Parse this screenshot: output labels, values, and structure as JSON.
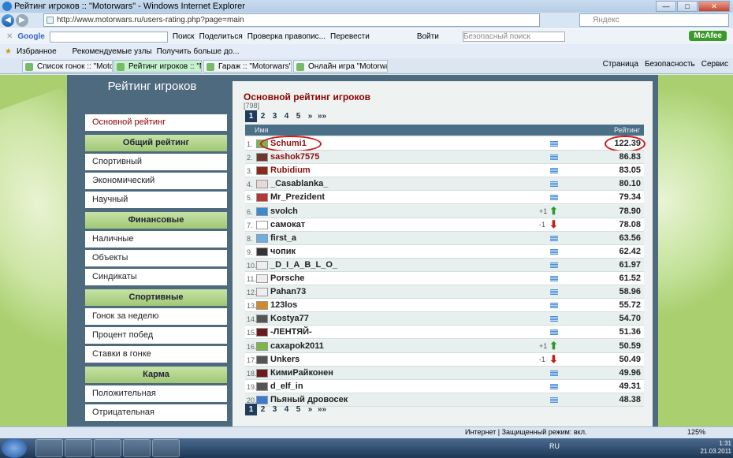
{
  "window": {
    "title": "Рейтинг игроков :: \"Motorwars\" - Windows Internet Explorer",
    "min": "—",
    "max": "□",
    "close": "✕"
  },
  "address": {
    "url": "http://www.motorwars.ru/users-rating.php?page=main",
    "search_placeholder": "Яндекс"
  },
  "google_bar": {
    "label": "Google",
    "search": "Поиск",
    "share": "Поделиться",
    "spell": "Проверка правопис...",
    "translate": "Перевести",
    "login": "Войти",
    "safe_search": "Безопасный поиск",
    "mcafee": "McAfee"
  },
  "favorites": {
    "label": "Избранное",
    "items": [
      "Рекомендуемые узлы",
      "Получить больше до..."
    ]
  },
  "tabs": [
    "Список гонок :: \"Motorwa...",
    "Рейтинг игроков :: \"M...",
    "Гараж :: \"Motorwars\"",
    "Онлайн игра \"Motorwars\""
  ],
  "ie_tools": [
    "Страница",
    "Безопасность",
    "Сервис"
  ],
  "sidebar": {
    "title": "Рейтинг игроков",
    "top": "Основной рейтинг",
    "sections": [
      {
        "head": "Общий рейтинг",
        "items": [
          "Спортивный",
          "Экономический",
          "Научный"
        ]
      },
      {
        "head": "Финансовые",
        "items": [
          "Наличные",
          "Объекты",
          "Синдикаты"
        ]
      },
      {
        "head": "Спортивные",
        "items": [
          "Гонок за неделю",
          "Процент побед",
          "Ставки в гонке"
        ]
      },
      {
        "head": "Карма",
        "items": [
          "Положительная",
          "Отрицательная"
        ]
      }
    ]
  },
  "main": {
    "title": "Основной рейтинг игроков",
    "count": "[798]",
    "pages": [
      "1",
      "2",
      "3",
      "4",
      "5",
      "»",
      "»»"
    ],
    "col_name": "Имя",
    "col_rating": "Рейтинг",
    "rows": [
      {
        "n": "1.",
        "name": "Schumi1",
        "rating": "122.39",
        "red": true,
        "delta": "",
        "dir": ""
      },
      {
        "n": "2.",
        "name": "sashok7575",
        "rating": "86.83",
        "red": true,
        "delta": "",
        "dir": ""
      },
      {
        "n": "3.",
        "name": "Rubidium",
        "rating": "83.05",
        "red": true,
        "delta": "",
        "dir": ""
      },
      {
        "n": "4.",
        "name": "_Casablanka_",
        "rating": "80.10",
        "red": false,
        "delta": "",
        "dir": ""
      },
      {
        "n": "5.",
        "name": "Mr_Prezident",
        "rating": "79.34",
        "red": false,
        "delta": "",
        "dir": ""
      },
      {
        "n": "6.",
        "name": "svolch",
        "rating": "78.90",
        "red": false,
        "delta": "+1",
        "dir": "up"
      },
      {
        "n": "7.",
        "name": "самокат",
        "rating": "78.08",
        "red": false,
        "delta": "-1",
        "dir": "down"
      },
      {
        "n": "8.",
        "name": "first_a",
        "rating": "63.56",
        "red": false,
        "delta": "",
        "dir": ""
      },
      {
        "n": "9.",
        "name": "чопик",
        "rating": "62.42",
        "red": false,
        "delta": "",
        "dir": ""
      },
      {
        "n": "10.",
        "name": "_D_I_A_B_L_O_",
        "rating": "61.97",
        "red": false,
        "delta": "",
        "dir": ""
      },
      {
        "n": "11.",
        "name": "Porsche",
        "rating": "61.52",
        "red": false,
        "delta": "",
        "dir": ""
      },
      {
        "n": "12.",
        "name": "Pahan73",
        "rating": "58.96",
        "red": false,
        "delta": "",
        "dir": ""
      },
      {
        "n": "13.",
        "name": "123los",
        "rating": "55.72",
        "red": false,
        "delta": "",
        "dir": ""
      },
      {
        "n": "14.",
        "name": "Kostya77",
        "rating": "54.70",
        "red": false,
        "delta": "",
        "dir": ""
      },
      {
        "n": "15.",
        "name": "-ЛЕНТЯЙ-",
        "rating": "51.36",
        "red": false,
        "delta": "",
        "dir": ""
      },
      {
        "n": "16.",
        "name": "caxapok2011",
        "rating": "50.59",
        "red": false,
        "delta": "+1",
        "dir": "up"
      },
      {
        "n": "17.",
        "name": "Unkers",
        "rating": "50.49",
        "red": false,
        "delta": "-1",
        "dir": "down"
      },
      {
        "n": "18.",
        "name": "КимиРайконен",
        "rating": "49.96",
        "red": false,
        "delta": "",
        "dir": ""
      },
      {
        "n": "19.",
        "name": "d_elf_in",
        "rating": "49.31",
        "red": false,
        "delta": "",
        "dir": ""
      },
      {
        "n": "20.",
        "name": "Пьяный дровосек",
        "rating": "48.38",
        "red": false,
        "delta": "",
        "dir": ""
      }
    ]
  },
  "status": {
    "zone": "Интернет | Защищенный режим: вкл.",
    "zoom": "125%"
  },
  "taskbar": {
    "lang": "RU",
    "time": "1:31",
    "date": "21.03.2011"
  }
}
